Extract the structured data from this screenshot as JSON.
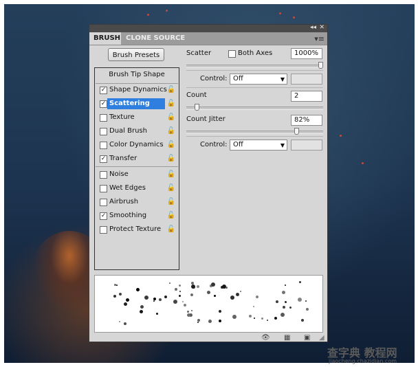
{
  "window": {
    "tabs": [
      {
        "label": "BRUSH",
        "active": true
      },
      {
        "label": "CLONE SOURCE",
        "active": false
      }
    ],
    "collapse_glyph": "◂◂",
    "close_glyph": "✕",
    "menu_glyph": "▾≡"
  },
  "left_panel": {
    "presets_button": "Brush Presets",
    "tip_shape_label": "Brush Tip Shape",
    "items": [
      {
        "label": "Shape Dynamics",
        "checked": true,
        "selected": false
      },
      {
        "label": "Scattering",
        "checked": true,
        "selected": true
      },
      {
        "label": "Texture",
        "checked": false,
        "selected": false
      },
      {
        "label": "Dual Brush",
        "checked": false,
        "selected": false
      },
      {
        "label": "Color Dynamics",
        "checked": false,
        "selected": false
      },
      {
        "label": "Transfer",
        "checked": true,
        "selected": false
      },
      {
        "label": "Noise",
        "checked": false,
        "selected": false
      },
      {
        "label": "Wet Edges",
        "checked": false,
        "selected": false
      },
      {
        "label": "Airbrush",
        "checked": false,
        "selected": false
      },
      {
        "label": "Smoothing",
        "checked": true,
        "selected": false
      },
      {
        "label": "Protect Texture",
        "checked": false,
        "selected": false
      }
    ]
  },
  "scatter": {
    "label": "Scatter",
    "both_axes_label": "Both Axes",
    "both_axes_checked": false,
    "value": "1000%",
    "slider_fraction": 1.0
  },
  "control1": {
    "label": "Control:",
    "value": "Off"
  },
  "count": {
    "label": "Count",
    "value": "2",
    "slider_fraction": 0.06
  },
  "count_jitter": {
    "label": "Count Jitter",
    "value": "82%",
    "slider_fraction": 0.82
  },
  "control2": {
    "label": "Control:",
    "value": "Off"
  },
  "icons": {
    "lock": "lock-icon",
    "eye": "eye-brush-icon",
    "grid": "grid-icon",
    "new": "new-preset-icon"
  },
  "watermark": {
    "main": "查字典 教程网",
    "url": "jiaocheng.chazidian.com"
  },
  "colors": {
    "panel_bg": "#d6d6d6",
    "selection": "#2f7fe0",
    "background_blue": "#1d3450"
  }
}
